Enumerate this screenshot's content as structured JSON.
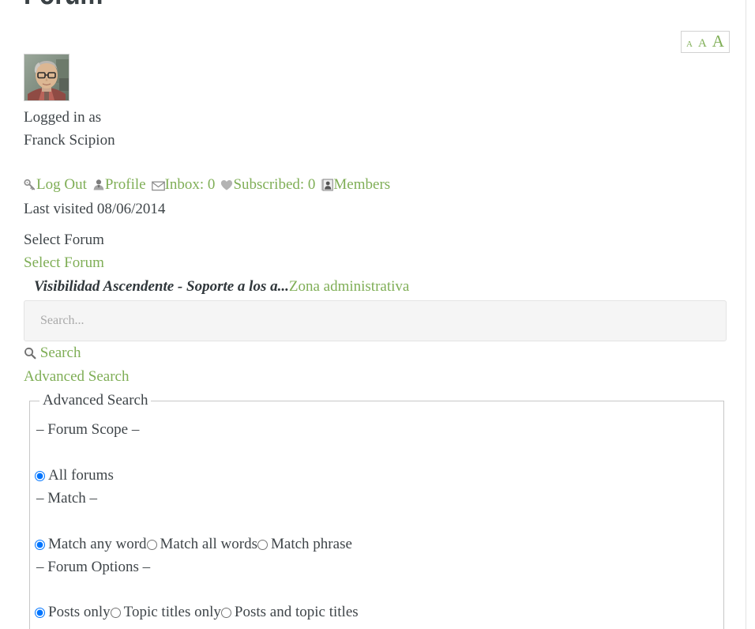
{
  "page": {
    "title": "Forum"
  },
  "font_resizer": {
    "small": "A",
    "medium": "A",
    "large": "A"
  },
  "user": {
    "logged_in_label": "Logged in as",
    "name": "Franck Scipion",
    "last_visited": "Last visited 08/06/2014",
    "avatar_icon": "user-avatar-photo"
  },
  "member_links": [
    {
      "label": "Log Out",
      "icon": "key-icon"
    },
    {
      "label": "Profile",
      "icon": "user-silhouette-icon"
    },
    {
      "label": "Inbox: 0",
      "icon": "envelope-icon"
    },
    {
      "label": "Subscribed: 0",
      "icon": "heart-icon"
    },
    {
      "label": "Members",
      "icon": "address-book-icon"
    }
  ],
  "forum_select": {
    "label": "Select Forum",
    "link": "Select Forum",
    "current_option": "Visibilidad Ascendente - Soporte a los a...",
    "admin_link": "Zona administrativa"
  },
  "search": {
    "placeholder": "Search...",
    "value": "",
    "submit_label": "Search",
    "submit_icon": "magnifier-icon",
    "advanced_link": "Advanced Search"
  },
  "advanced_search": {
    "legend": "Advanced Search",
    "groups": [
      {
        "label": "– Forum Scope –",
        "options": [
          {
            "label": "All forums",
            "checked": true
          }
        ]
      },
      {
        "label": "– Match –",
        "options": [
          {
            "label": "Match any word",
            "checked": true
          },
          {
            "label": "Match all words",
            "checked": false
          },
          {
            "label": "Match phrase",
            "checked": false
          }
        ]
      },
      {
        "label": "– Forum Options –",
        "options": [
          {
            "label": "Posts only",
            "checked": true
          },
          {
            "label": "Topic titles only",
            "checked": false
          },
          {
            "label": "Posts and topic titles",
            "checked": false
          }
        ]
      }
    ]
  },
  "colors": {
    "link_green": "#7fae56",
    "text_dark": "#3f4549",
    "field_bg": "#f5f5f5",
    "border": "#c7c7c7"
  }
}
